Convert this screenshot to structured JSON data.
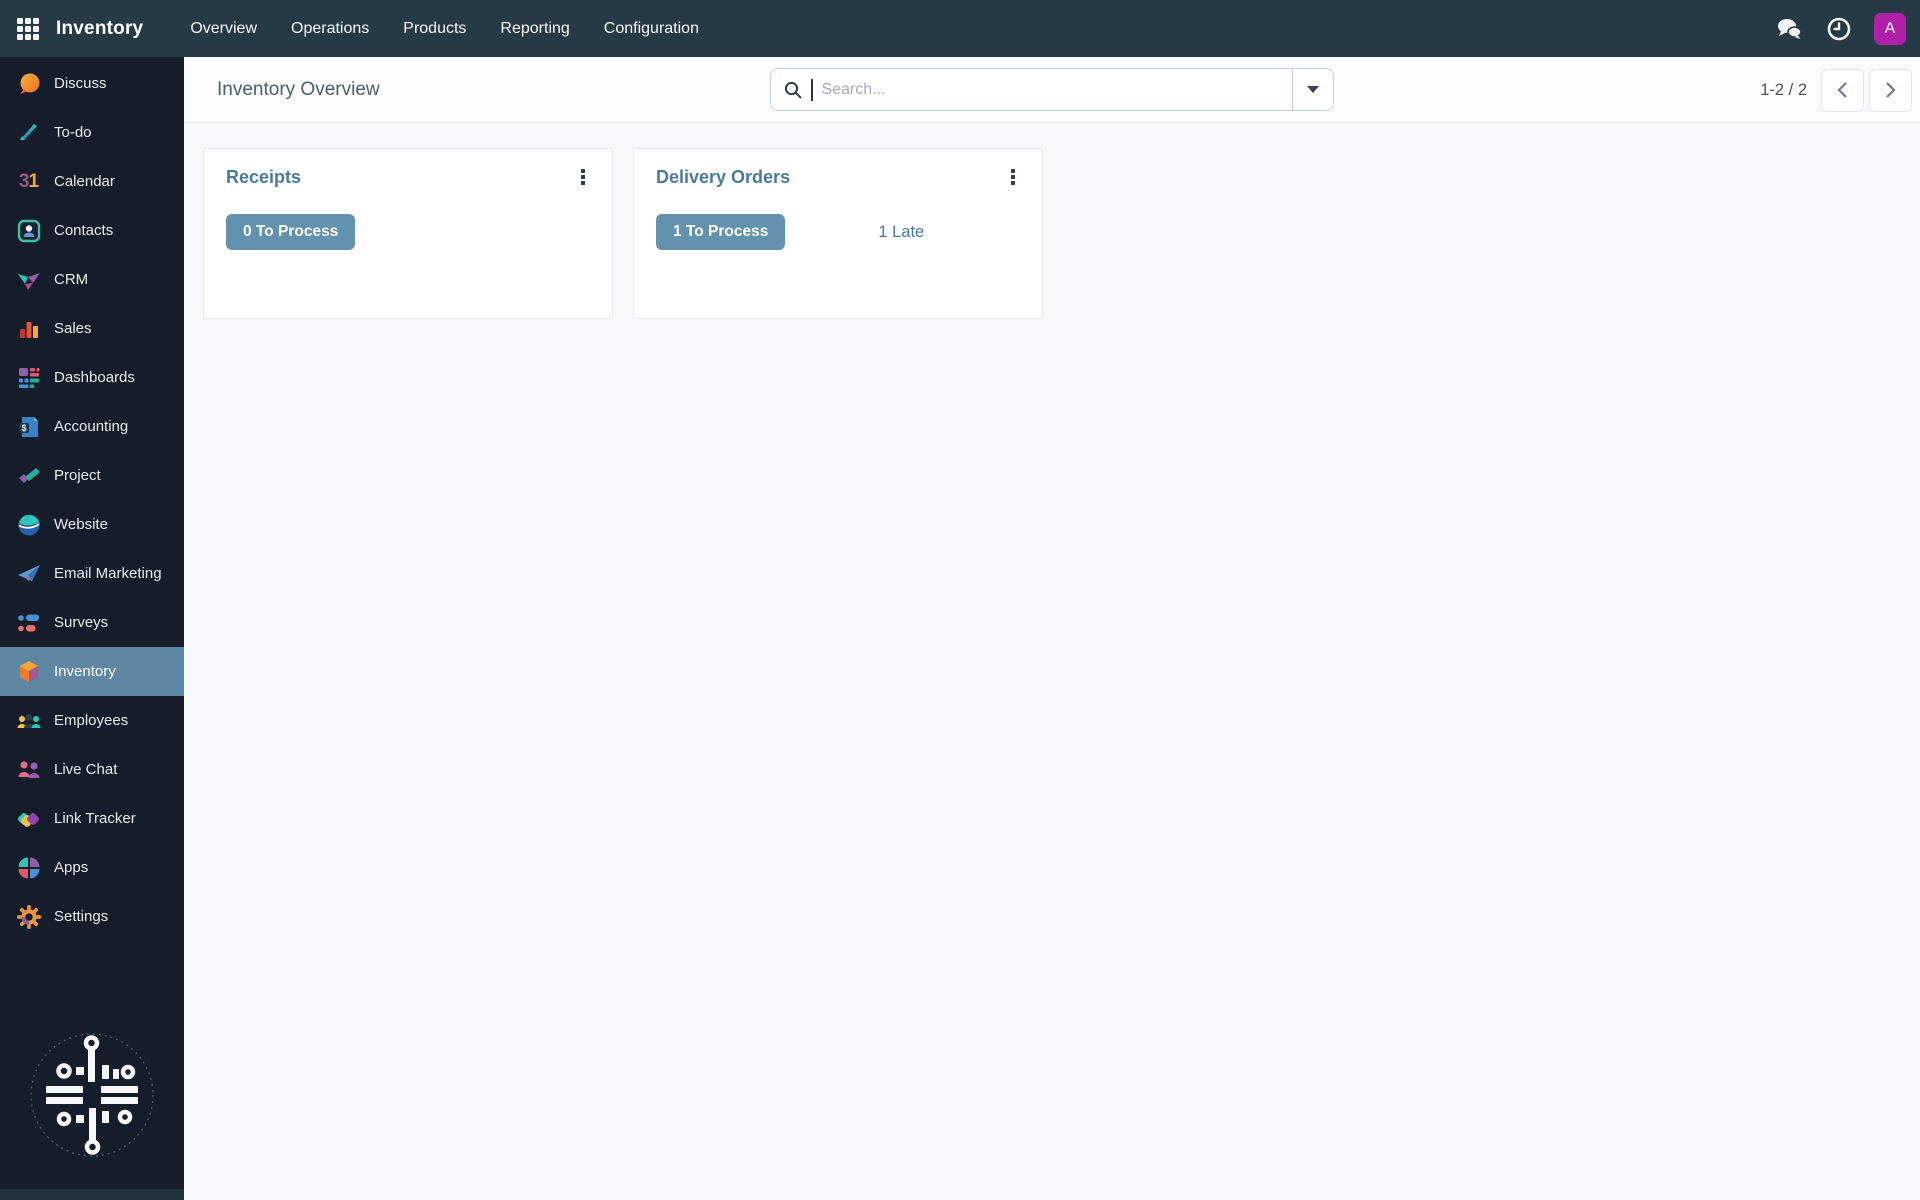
{
  "navbar": {
    "brand": "Inventory",
    "menu": [
      {
        "label": "Overview"
      },
      {
        "label": "Operations"
      },
      {
        "label": "Products"
      },
      {
        "label": "Reporting"
      },
      {
        "label": "Configuration"
      }
    ],
    "avatar_letter": "A"
  },
  "sidebar": {
    "items": [
      {
        "label": "Discuss"
      },
      {
        "label": "To-do"
      },
      {
        "label": "Calendar"
      },
      {
        "label": "Contacts"
      },
      {
        "label": "CRM"
      },
      {
        "label": "Sales"
      },
      {
        "label": "Dashboards"
      },
      {
        "label": "Accounting"
      },
      {
        "label": "Project"
      },
      {
        "label": "Website"
      },
      {
        "label": "Email Marketing"
      },
      {
        "label": "Surveys"
      },
      {
        "label": "Inventory",
        "active": true
      },
      {
        "label": "Employees"
      },
      {
        "label": "Live Chat"
      },
      {
        "label": "Link Tracker"
      },
      {
        "label": "Apps"
      },
      {
        "label": "Settings"
      }
    ],
    "icon_glyphs": {
      "calendar_3": "3",
      "calendar_1": "1",
      "accounting_dollar": "$"
    }
  },
  "control_panel": {
    "title": "Inventory Overview",
    "search": {
      "placeholder": "Search..."
    },
    "pager": {
      "range": "1-2 / 2"
    }
  },
  "cards": [
    {
      "title": "Receipts",
      "primary_button": "0 To Process",
      "late_link": ""
    },
    {
      "title": "Delivery Orders",
      "primary_button": "1 To Process",
      "late_link": "1 Late"
    }
  ],
  "colors": {
    "navbar_bg": "#263a46",
    "sidebar_bg": "#151c2a",
    "active_item_bg": "#5d87a2",
    "button_bg": "#6292ad",
    "steel_text": "#4a7a9d",
    "avatar_bg": "#b01fa7",
    "content_bg": "#f8f9fa"
  }
}
